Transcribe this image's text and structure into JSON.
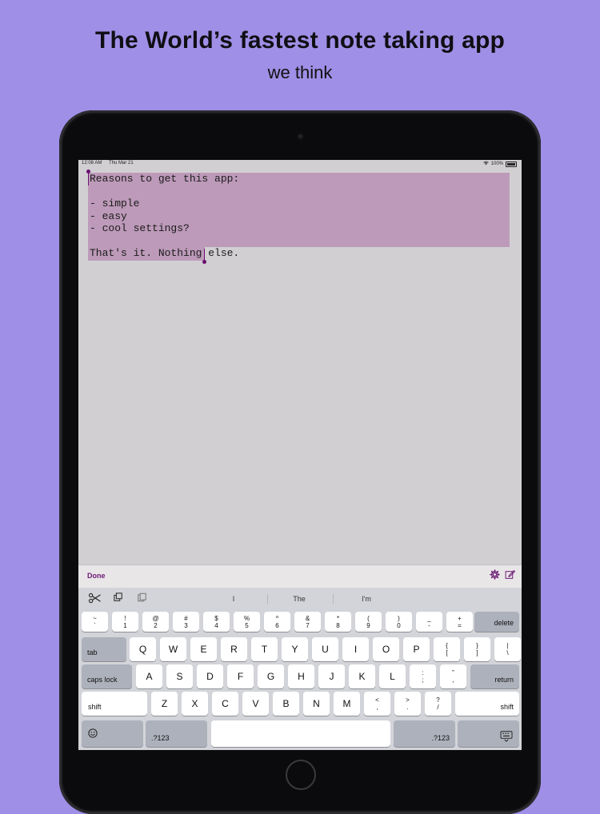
{
  "header": {
    "title": "The World’s fastest note taking app",
    "subtitle": "we think"
  },
  "status_bar": {
    "time": "12:08 AM",
    "date": "Thu Mar 21",
    "battery": "100%",
    "battery_level": 1.0
  },
  "note": {
    "text": "Reasons to get this app:\n\n- simple\n- easy\n- cool settings?\n\nThat's it. Nothing else."
  },
  "toolbar": {
    "done_label": "Done",
    "settings_icon": "gear-icon",
    "compose_icon": "compose-icon"
  },
  "keyboard": {
    "shortcut_icons": [
      "cut-icon",
      "copy-icon",
      "paste-icon"
    ],
    "suggestions": [
      "I",
      "The",
      "I'm"
    ],
    "number_row": [
      {
        "top": "~",
        "bottom": "`"
      },
      {
        "top": "!",
        "bottom": "1"
      },
      {
        "top": "@",
        "bottom": "2"
      },
      {
        "top": "#",
        "bottom": "3"
      },
      {
        "top": "$",
        "bottom": "4"
      },
      {
        "top": "%",
        "bottom": "5"
      },
      {
        "top": "^",
        "bottom": "6"
      },
      {
        "top": "&",
        "bottom": "7"
      },
      {
        "top": "*",
        "bottom": "8"
      },
      {
        "top": "(",
        "bottom": "9"
      },
      {
        "top": ")",
        "bottom": "0"
      },
      {
        "top": "_",
        "bottom": "-"
      },
      {
        "top": "+",
        "bottom": "="
      }
    ],
    "delete_label": "delete",
    "tab_label": "tab",
    "row_q": [
      "Q",
      "W",
      "E",
      "R",
      "T",
      "Y",
      "U",
      "I",
      "O",
      "P"
    ],
    "row_q_extra": [
      {
        "top": "{",
        "bottom": "["
      },
      {
        "top": "}",
        "bottom": "]"
      },
      {
        "top": "|",
        "bottom": "\\"
      }
    ],
    "caps_lock_label": "caps lock",
    "row_a": [
      "A",
      "S",
      "D",
      "F",
      "G",
      "H",
      "J",
      "K",
      "L"
    ],
    "row_a_extra": [
      {
        "top": ":",
        "bottom": ";"
      },
      {
        "top": "”",
        "bottom": ","
      }
    ],
    "return_label": "return",
    "shift_label": "shift",
    "row_z": [
      "Z",
      "X",
      "C",
      "V",
      "B",
      "N",
      "M"
    ],
    "row_z_extra": [
      {
        "top": "<",
        "bottom": ","
      },
      {
        "top": ">",
        "bottom": "."
      },
      {
        "top": "?",
        "bottom": "/"
      }
    ],
    "emoji_icon": "emoji-icon",
    "numbers_label": ".?123",
    "dismiss_icon": "keyboard-dismiss-icon"
  }
}
